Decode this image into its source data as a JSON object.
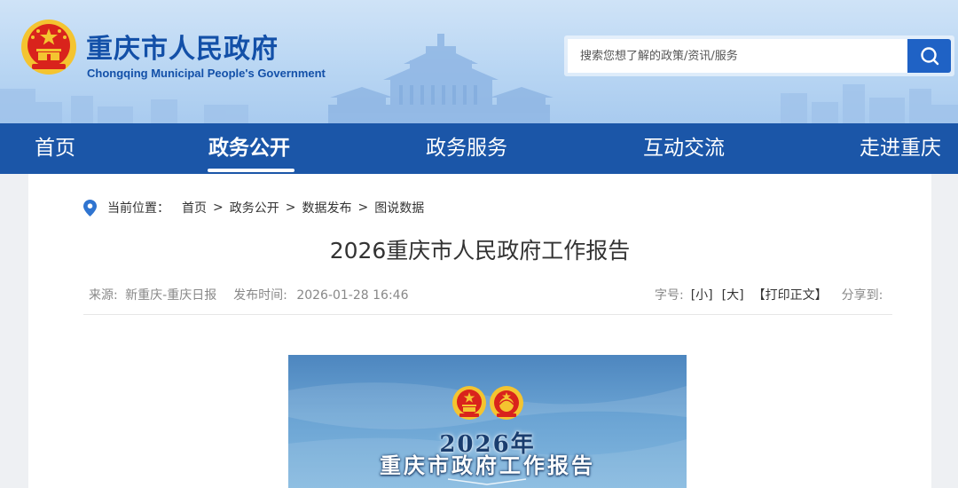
{
  "header": {
    "site_title": "重庆市人民政府",
    "site_subtitle": "Chongqing Municipal People's Government",
    "search_placeholder": "搜索您想了解的政策/资讯/服务"
  },
  "nav": {
    "items": [
      {
        "label": "首页"
      },
      {
        "label": "政务公开"
      },
      {
        "label": "政务服务"
      },
      {
        "label": "互动交流"
      },
      {
        "label": "走进重庆"
      }
    ],
    "active_index": 1
  },
  "breadcrumb": {
    "label": "当前位置：",
    "items": [
      "首页",
      "政务公开",
      "数据发布",
      "图说数据"
    ],
    "separator": ">"
  },
  "article": {
    "title": "2026重庆市人民政府工作报告",
    "source_label": "来源:",
    "source": "新重庆-重庆日报",
    "publish_label": "发布时间:",
    "publish_time": "2026-01-28 16:46",
    "font_size_label": "字号:",
    "font_small": "[小]",
    "font_large": "[大]",
    "print": "【打印正文】",
    "share_label": "分享到:"
  },
  "poster": {
    "year": "2026年",
    "title": "重庆市政府工作报告"
  },
  "colors": {
    "nav_bg": "#1b56a8",
    "title_blue": "#1350a8",
    "search_button": "#1f62c5",
    "emblem_red": "#d9231c",
    "emblem_gold": "#f4c430"
  }
}
